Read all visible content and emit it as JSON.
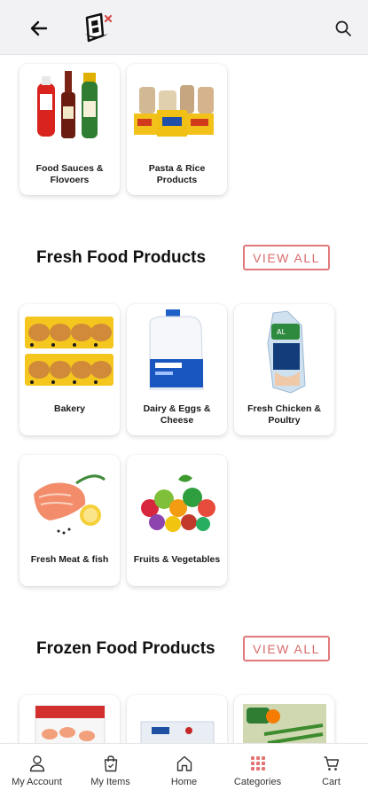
{
  "header": {
    "back_icon": "arrow-left-icon",
    "logo_icon": "store-logo-icon",
    "search_icon": "search-icon"
  },
  "top_categories": [
    {
      "label": "Food Sauces & Flovoers"
    },
    {
      "label": "Pasta & Rice Products"
    }
  ],
  "sections": [
    {
      "title": "Fresh Food Products",
      "view_all": "VIEW ALL",
      "items": [
        {
          "label": "Bakery"
        },
        {
          "label": "Dairy & Eggs & Cheese"
        },
        {
          "label": "Fresh Chicken & Poultry"
        },
        {
          "label": "Fresh Meat & fish"
        },
        {
          "label": "Fruits & Vegetables"
        }
      ]
    },
    {
      "title": "Frozen Food Products",
      "view_all": "VIEW ALL",
      "items": [
        {
          "label": ""
        },
        {
          "label": ""
        },
        {
          "label": ""
        }
      ]
    }
  ],
  "bottom_nav": [
    {
      "label": "My Account",
      "icon": "user-icon"
    },
    {
      "label": "My Items",
      "icon": "bag-icon"
    },
    {
      "label": "Home",
      "icon": "home-icon"
    },
    {
      "label": "Categories",
      "icon": "grid-icon"
    },
    {
      "label": "Cart",
      "icon": "cart-icon"
    }
  ],
  "colors": {
    "accent": "#d86a6a",
    "header_bg": "#f2f2f5"
  }
}
